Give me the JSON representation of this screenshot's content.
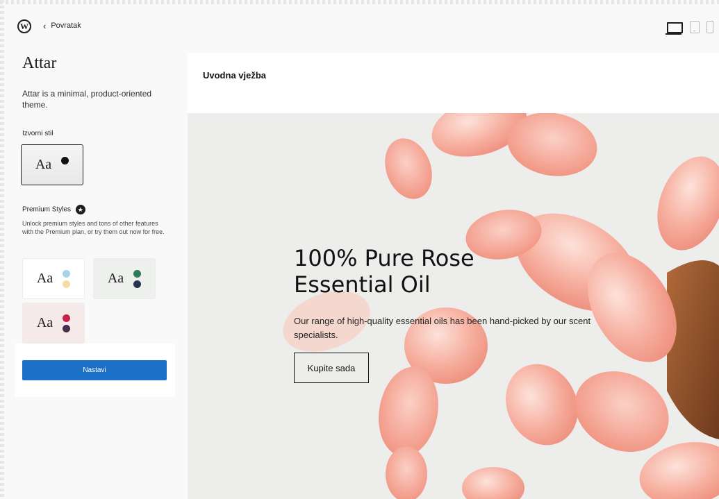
{
  "topbar": {
    "logo_glyph": "W",
    "back_label": "Povratak",
    "devices": [
      "desktop-icon",
      "tablet-icon",
      "mobile-icon"
    ]
  },
  "sidebar": {
    "theme_name": "Attar",
    "theme_description": "Attar is a minimal, product-oriented theme.",
    "default_style_label": "Izvorni stil",
    "premium_label": "Premium Styles",
    "premium_description": "Unlock premium styles and tons of other features with the Premium plan, or try them out now for free.",
    "style_sample": "Aa",
    "styles": [
      {
        "colors": [
          "#111111"
        ]
      },
      {
        "colors": [
          "#a9d3e6",
          "#f2dda5"
        ]
      },
      {
        "colors": [
          "#2f7a5a",
          "#253452"
        ]
      },
      {
        "colors": [
          "#c8234a",
          "#4a2e4a"
        ]
      }
    ],
    "continue_label": "Nastavi"
  },
  "preview": {
    "site_title": "Uvodna vježba",
    "hero_heading": "100% Pure Rose Essential Oil",
    "hero_text": "Our range of high-quality essential oils has been hand-picked by our scent specialists.",
    "hero_button": "Kupite sada"
  },
  "colors": {
    "accent": "#1d70c7",
    "petal": "#f4a99b"
  }
}
